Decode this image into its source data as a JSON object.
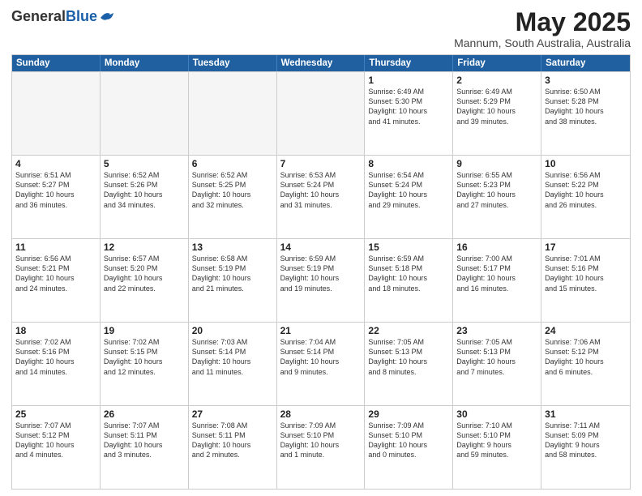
{
  "header": {
    "logo_general": "General",
    "logo_blue": "Blue",
    "title": "May 2025",
    "subtitle": "Mannum, South Australia, Australia"
  },
  "days_of_week": [
    "Sunday",
    "Monday",
    "Tuesday",
    "Wednesday",
    "Thursday",
    "Friday",
    "Saturday"
  ],
  "weeks": [
    [
      {
        "num": "",
        "info": ""
      },
      {
        "num": "",
        "info": ""
      },
      {
        "num": "",
        "info": ""
      },
      {
        "num": "",
        "info": ""
      },
      {
        "num": "1",
        "info": "Sunrise: 6:49 AM\nSunset: 5:30 PM\nDaylight: 10 hours\nand 41 minutes."
      },
      {
        "num": "2",
        "info": "Sunrise: 6:49 AM\nSunset: 5:29 PM\nDaylight: 10 hours\nand 39 minutes."
      },
      {
        "num": "3",
        "info": "Sunrise: 6:50 AM\nSunset: 5:28 PM\nDaylight: 10 hours\nand 38 minutes."
      }
    ],
    [
      {
        "num": "4",
        "info": "Sunrise: 6:51 AM\nSunset: 5:27 PM\nDaylight: 10 hours\nand 36 minutes."
      },
      {
        "num": "5",
        "info": "Sunrise: 6:52 AM\nSunset: 5:26 PM\nDaylight: 10 hours\nand 34 minutes."
      },
      {
        "num": "6",
        "info": "Sunrise: 6:52 AM\nSunset: 5:25 PM\nDaylight: 10 hours\nand 32 minutes."
      },
      {
        "num": "7",
        "info": "Sunrise: 6:53 AM\nSunset: 5:24 PM\nDaylight: 10 hours\nand 31 minutes."
      },
      {
        "num": "8",
        "info": "Sunrise: 6:54 AM\nSunset: 5:24 PM\nDaylight: 10 hours\nand 29 minutes."
      },
      {
        "num": "9",
        "info": "Sunrise: 6:55 AM\nSunset: 5:23 PM\nDaylight: 10 hours\nand 27 minutes."
      },
      {
        "num": "10",
        "info": "Sunrise: 6:56 AM\nSunset: 5:22 PM\nDaylight: 10 hours\nand 26 minutes."
      }
    ],
    [
      {
        "num": "11",
        "info": "Sunrise: 6:56 AM\nSunset: 5:21 PM\nDaylight: 10 hours\nand 24 minutes."
      },
      {
        "num": "12",
        "info": "Sunrise: 6:57 AM\nSunset: 5:20 PM\nDaylight: 10 hours\nand 22 minutes."
      },
      {
        "num": "13",
        "info": "Sunrise: 6:58 AM\nSunset: 5:19 PM\nDaylight: 10 hours\nand 21 minutes."
      },
      {
        "num": "14",
        "info": "Sunrise: 6:59 AM\nSunset: 5:19 PM\nDaylight: 10 hours\nand 19 minutes."
      },
      {
        "num": "15",
        "info": "Sunrise: 6:59 AM\nSunset: 5:18 PM\nDaylight: 10 hours\nand 18 minutes."
      },
      {
        "num": "16",
        "info": "Sunrise: 7:00 AM\nSunset: 5:17 PM\nDaylight: 10 hours\nand 16 minutes."
      },
      {
        "num": "17",
        "info": "Sunrise: 7:01 AM\nSunset: 5:16 PM\nDaylight: 10 hours\nand 15 minutes."
      }
    ],
    [
      {
        "num": "18",
        "info": "Sunrise: 7:02 AM\nSunset: 5:16 PM\nDaylight: 10 hours\nand 14 minutes."
      },
      {
        "num": "19",
        "info": "Sunrise: 7:02 AM\nSunset: 5:15 PM\nDaylight: 10 hours\nand 12 minutes."
      },
      {
        "num": "20",
        "info": "Sunrise: 7:03 AM\nSunset: 5:14 PM\nDaylight: 10 hours\nand 11 minutes."
      },
      {
        "num": "21",
        "info": "Sunrise: 7:04 AM\nSunset: 5:14 PM\nDaylight: 10 hours\nand 9 minutes."
      },
      {
        "num": "22",
        "info": "Sunrise: 7:05 AM\nSunset: 5:13 PM\nDaylight: 10 hours\nand 8 minutes."
      },
      {
        "num": "23",
        "info": "Sunrise: 7:05 AM\nSunset: 5:13 PM\nDaylight: 10 hours\nand 7 minutes."
      },
      {
        "num": "24",
        "info": "Sunrise: 7:06 AM\nSunset: 5:12 PM\nDaylight: 10 hours\nand 6 minutes."
      }
    ],
    [
      {
        "num": "25",
        "info": "Sunrise: 7:07 AM\nSunset: 5:12 PM\nDaylight: 10 hours\nand 4 minutes."
      },
      {
        "num": "26",
        "info": "Sunrise: 7:07 AM\nSunset: 5:11 PM\nDaylight: 10 hours\nand 3 minutes."
      },
      {
        "num": "27",
        "info": "Sunrise: 7:08 AM\nSunset: 5:11 PM\nDaylight: 10 hours\nand 2 minutes."
      },
      {
        "num": "28",
        "info": "Sunrise: 7:09 AM\nSunset: 5:10 PM\nDaylight: 10 hours\nand 1 minute."
      },
      {
        "num": "29",
        "info": "Sunrise: 7:09 AM\nSunset: 5:10 PM\nDaylight: 10 hours\nand 0 minutes."
      },
      {
        "num": "30",
        "info": "Sunrise: 7:10 AM\nSunset: 5:10 PM\nDaylight: 9 hours\nand 59 minutes."
      },
      {
        "num": "31",
        "info": "Sunrise: 7:11 AM\nSunset: 5:09 PM\nDaylight: 9 hours\nand 58 minutes."
      }
    ]
  ]
}
